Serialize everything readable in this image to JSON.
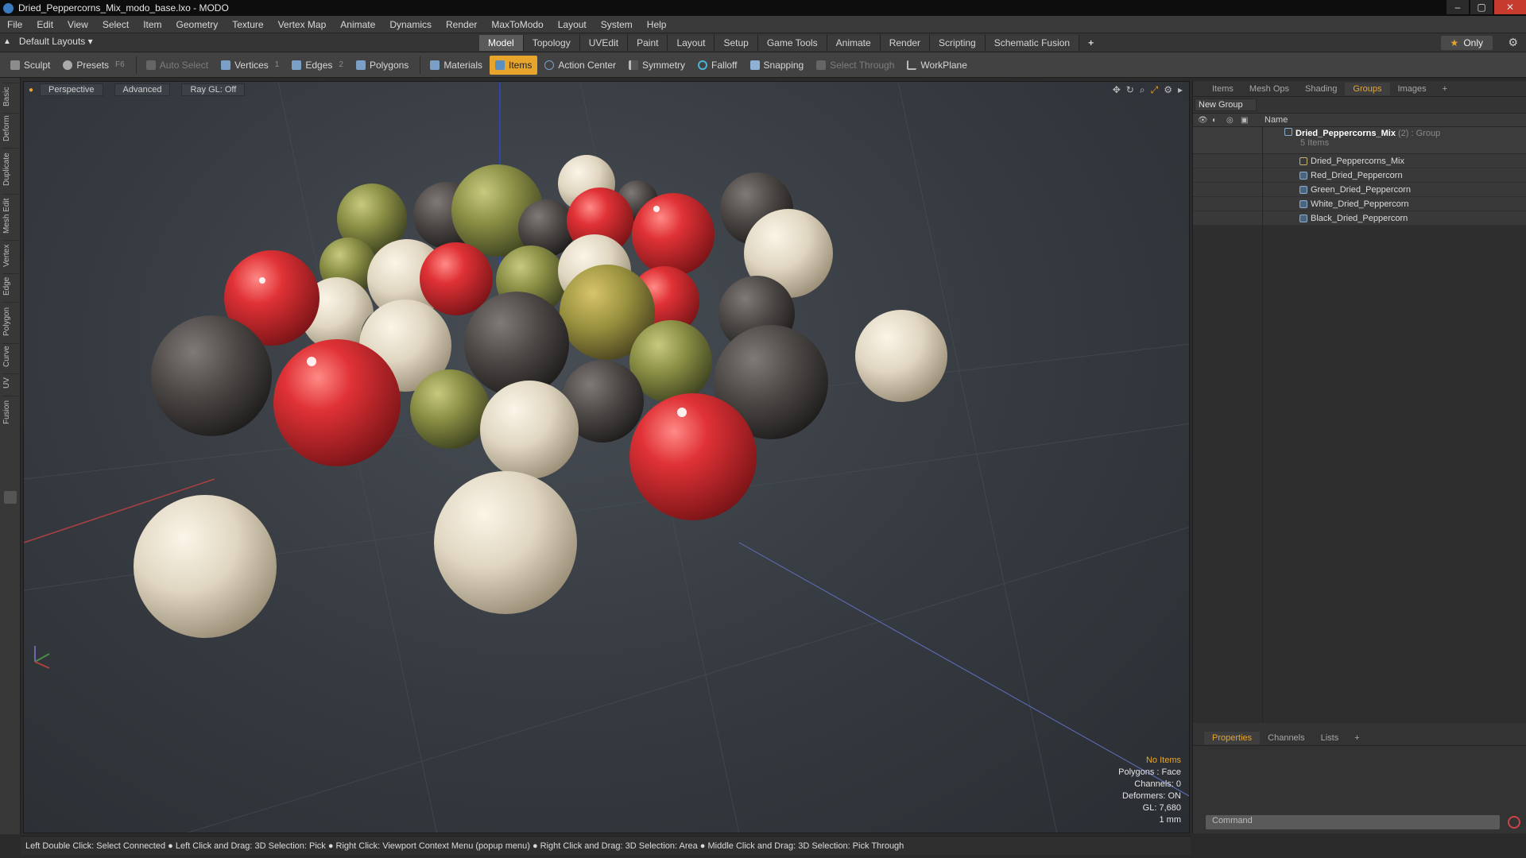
{
  "window": {
    "title": "Dried_Peppercorns_Mix_modo_base.lxo - MODO"
  },
  "menu": [
    "File",
    "Edit",
    "View",
    "Select",
    "Item",
    "Geometry",
    "Texture",
    "Vertex Map",
    "Animate",
    "Dynamics",
    "Render",
    "MaxToModo",
    "Layout",
    "System",
    "Help"
  ],
  "layouts": {
    "label": "Default Layouts"
  },
  "tabs": [
    "Model",
    "Topology",
    "UVEdit",
    "Paint",
    "Layout",
    "Setup",
    "Game Tools",
    "Animate",
    "Render",
    "Scripting",
    "Schematic Fusion"
  ],
  "tabs_active": "Model",
  "only_label": "Only",
  "toolbar": {
    "sculpt": "Sculpt",
    "presets": "Presets",
    "presets_key": "F6",
    "auto_select": "Auto Select",
    "vertices": "Vertices",
    "vertices_count": "1",
    "edges": "Edges",
    "edges_count": "2",
    "polygons": "Polygons",
    "materials": "Materials",
    "items": "Items",
    "action_center": "Action Center",
    "symmetry": "Symmetry",
    "falloff": "Falloff",
    "snapping": "Snapping",
    "select_through": "Select Through",
    "workplane": "WorkPlane"
  },
  "left_tabs": [
    "Basic",
    "Deform",
    "Duplicate",
    "Mesh Edit",
    "Vertex",
    "Edge",
    "Polygon",
    "Curve",
    "UV",
    "Fusion"
  ],
  "viewport": {
    "perspective": "Perspective",
    "advanced": "Advanced",
    "raygl": "Ray GL: Off"
  },
  "hud": {
    "no_items": "No Items",
    "polygons": "Polygons : Face",
    "channels": "Channels: 0",
    "deformers": "Deformers: ON",
    "gl": "GL: 7,680",
    "unit": "1 mm"
  },
  "statusbar": "Left Double Click: Select Connected ● Left Click and Drag: 3D Selection: Pick ● Right Click: Viewport Context Menu (popup menu) ● Right Click and Drag: 3D Selection: Area ● Middle Click and Drag: 3D Selection: Pick Through",
  "panel_tabs": [
    "Items",
    "Mesh Ops",
    "Shading",
    "Groups",
    "Images"
  ],
  "panel_tabs_active": "Groups",
  "new_group": "New Group",
  "tree_header": "Name",
  "group": {
    "name": "Dried_Peppercorns_Mix",
    "count": "(2)",
    "type": ": Group",
    "items": "5 Items"
  },
  "tree_items": [
    "Dried_Peppercorns_Mix",
    "Red_Dried_Peppercorn",
    "Green_Dried_Peppercorn",
    "White_Dried_Peppercorn",
    "Black_Dried_Peppercorn"
  ],
  "bottom_tabs": [
    "Properties",
    "Channels",
    "Lists"
  ],
  "bottom_tabs_active": "Properties",
  "command_placeholder": "Command",
  "colors": {
    "accent": "#e8a52b",
    "red_pepper": "#d32a2e",
    "green_pepper": "#7d8a3c",
    "white_pepper": "#e6ddc9",
    "black_pepper": "#4a4644"
  }
}
